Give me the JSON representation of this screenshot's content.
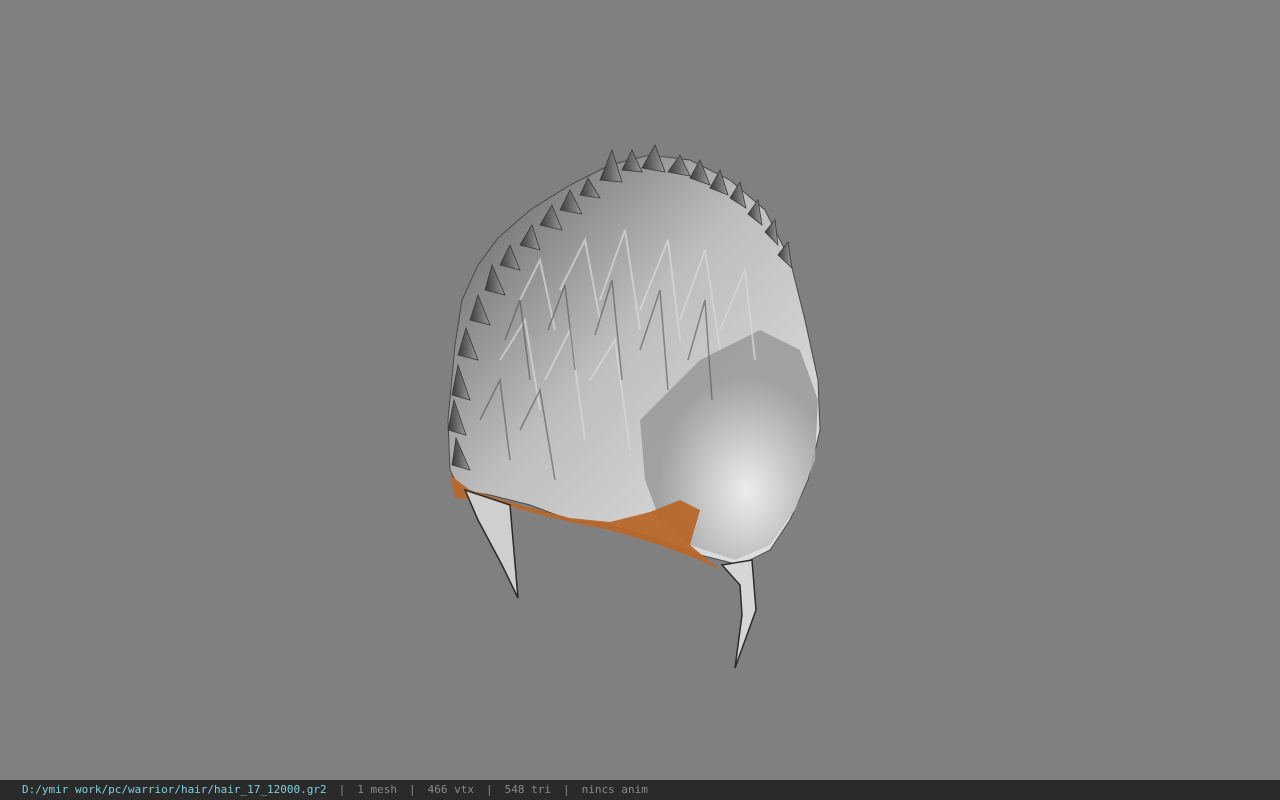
{
  "viewport": {
    "background_color": "#808080",
    "model_icon": "hair-mesh"
  },
  "status_bar": {
    "file_path": "D:/ymir work/pc/warrior/hair/hair_17_12000.gr2",
    "separator": "|",
    "mesh_count": "1 mesh",
    "vertex_count": "466 vtx",
    "triangle_count": "548 tri",
    "animation": "nincs anim",
    "path_color": "#7fd0e0",
    "text_color": "#8a8a8a"
  }
}
